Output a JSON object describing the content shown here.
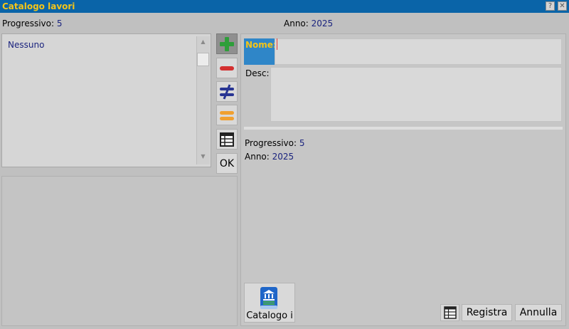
{
  "window": {
    "title": "Catalogo lavori",
    "help_label": "?",
    "close_label": "✕"
  },
  "header": {
    "progressivo_label": "Progressivo:",
    "progressivo_value": "5",
    "anno_label": "Anno:",
    "anno_value": "2025"
  },
  "list": {
    "items": [
      "Nessuno"
    ]
  },
  "side_buttons": {
    "add_icon": "plus-icon",
    "remove_icon": "minus-icon",
    "not_equal_icon": "not-equal-icon",
    "equal_icon": "equal-icon",
    "table_icon": "table-icon",
    "ok_label": "OK"
  },
  "form": {
    "nome_label": "Nome:",
    "nome_value": "",
    "desc_label": "Desc:",
    "desc_value": ""
  },
  "details": {
    "progressivo_label": "Progressivo:",
    "progressivo_value": "5",
    "anno_label": "Anno:",
    "anno_value": "2025"
  },
  "footer": {
    "catalog_label": "Catalogo i",
    "registra_label": "Registra",
    "annulla_label": "Annulla"
  },
  "colors": {
    "titlebar": "#0a64a8",
    "title_text": "#f5c518",
    "value_text": "#1a237e",
    "add_green": "#2e9e3a",
    "remove_red": "#d32f2f",
    "not_equal_blue": "#283593",
    "equal_orange": "#f0a030",
    "nome_bg": "#2f86c8"
  }
}
